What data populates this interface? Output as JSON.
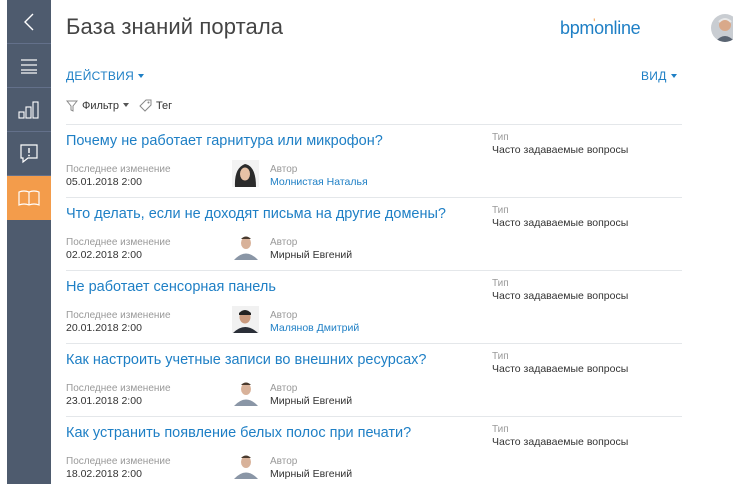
{
  "header": {
    "title": "База знаний портала",
    "logo_text_a": "bpm",
    "logo_text_b": "online"
  },
  "toolbar": {
    "actions_label": "ДЕЙСТВИЯ",
    "view_label": "ВИД",
    "filter_label": "Фильтр",
    "tag_label": "Тег"
  },
  "sidebar": {
    "items": [
      {
        "icon": "back-arrow-icon"
      },
      {
        "icon": "menu-icon"
      },
      {
        "icon": "dashboard-icon"
      },
      {
        "icon": "feed-icon"
      },
      {
        "icon": "knowledge-base-icon",
        "active": true
      }
    ],
    "active_color": "#f39c4b",
    "background": "#4e5b6e"
  },
  "labels": {
    "last_modified": "Последнее изменение",
    "author": "Автор",
    "type": "Тип"
  },
  "articles": [
    {
      "title": "Почему не работает гарнитура или микрофон?",
      "date": "05.01.2018 2:00",
      "author": "Молнистая Наталья",
      "author_linked": true,
      "type": "Часто задаваемые вопросы"
    },
    {
      "title": "Что делать, если не доходят письма на другие домены?",
      "date": "02.02.2018 2:00",
      "author": "Мирный Евгений",
      "author_linked": false,
      "type": "Часто задаваемые вопросы"
    },
    {
      "title": "Не работает сенсорная панель",
      "date": "20.01.2018 2:00",
      "author": "Малянов Дмитрий",
      "author_linked": true,
      "type": "Часто задаваемые вопросы"
    },
    {
      "title": "Как настроить учетные записи во внешних ресурсах?",
      "date": "23.01.2018 2:00",
      "author": "Мирный Евгений",
      "author_linked": false,
      "type": "Часто задаваемые вопросы"
    },
    {
      "title": "Как устранить появление белых полос при печати?",
      "date": "18.02.2018 2:00",
      "author": "Мирный Евгений",
      "author_linked": false,
      "type": "Часто задаваемые вопросы"
    }
  ],
  "colors": {
    "accent": "#1e7fc5",
    "brand_orange": "#f39c4b"
  }
}
